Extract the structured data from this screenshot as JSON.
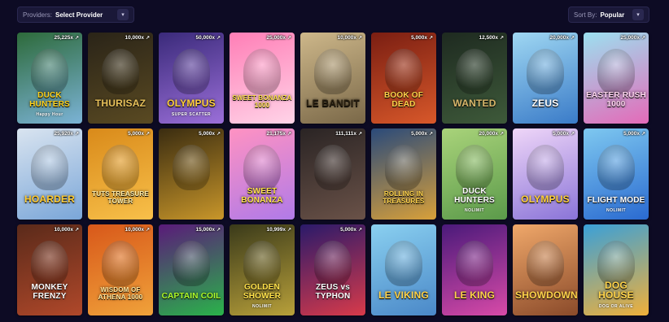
{
  "filters": {
    "providers_label": "Providers:",
    "providers_value": "Select Provider",
    "sort_label": "Sort By:",
    "sort_value": "Popular"
  },
  "games": [
    {
      "title": "DUCK HUNTERS",
      "subtitle": "Happy Hour",
      "multiplier": "25,225x",
      "bg": [
        "#2d6a3a",
        "#7bb3d6"
      ],
      "color": "#ffd21c"
    },
    {
      "title": "THURISAZ",
      "subtitle": "",
      "multiplier": "10,000x",
      "bg": [
        "#2a2418",
        "#5a4a22"
      ],
      "color": "#e8c15a"
    },
    {
      "title": "OLYMPUS",
      "subtitle": "SUPER SCATTER",
      "multiplier": "50,000x",
      "bg": [
        "#3a2a7a",
        "#9b6fd9"
      ],
      "color": "#ffcf3a"
    },
    {
      "title": "SWEET BONANZA 1000",
      "subtitle": "",
      "multiplier": "25,000x",
      "bg": [
        "#ff7eb6",
        "#ffd4e8"
      ],
      "color": "#ffe14a"
    },
    {
      "title": "LE BANDIT",
      "subtitle": "",
      "multiplier": "10,000x",
      "bg": [
        "#cdb78a",
        "#7a6848"
      ],
      "color": "#2a2010"
    },
    {
      "title": "BOOK OF DEAD",
      "subtitle": "",
      "multiplier": "5,000x",
      "bg": [
        "#7a1e12",
        "#d8582a"
      ],
      "color": "#ffd34a"
    },
    {
      "title": "WANTED",
      "subtitle": "",
      "multiplier": "12,500x",
      "bg": [
        "#1e2a20",
        "#3e5a3a"
      ],
      "color": "#d8b66a"
    },
    {
      "title": "ZEUS",
      "subtitle": "",
      "multiplier": "20,000x",
      "bg": [
        "#9fd7f2",
        "#3a7bc8"
      ],
      "color": "#ffffff"
    },
    {
      "title": "EASTER RUSH 1000",
      "subtitle": "",
      "multiplier": "25,000x",
      "bg": [
        "#9ce0f0",
        "#e46ab8"
      ],
      "color": "#ffd6f0"
    },
    {
      "title": "HOARDER",
      "subtitle": "",
      "multiplier": "25,920x",
      "bg": [
        "#d9e4f0",
        "#7aa6d8"
      ],
      "color": "#ffcc33"
    },
    {
      "title": "TUTS TREASURE TOWER",
      "subtitle": "",
      "multiplier": "5,000x",
      "bg": [
        "#d98a1a",
        "#f8c04a"
      ],
      "color": "#fff0b0"
    },
    {
      "title": "",
      "subtitle": "",
      "multiplier": "5,000x",
      "bg": [
        "#3a2c10",
        "#c8962a"
      ],
      "color": "#ffd34a"
    },
    {
      "title": "SWEET BONANZA",
      "subtitle": "",
      "multiplier": "21,175x",
      "bg": [
        "#ff92c2",
        "#b07ae8"
      ],
      "color": "#ffe14a"
    },
    {
      "title": "",
      "subtitle": "",
      "multiplier": "111,111x",
      "bg": [
        "#2a2424",
        "#6a5248"
      ],
      "color": "#e8c79a"
    },
    {
      "title": "ROLLING IN TREASURES",
      "subtitle": "",
      "multiplier": "5,000x",
      "bg": [
        "#2a4a7a",
        "#d8a03a"
      ],
      "color": "#ffd34a"
    },
    {
      "title": "DUCK HUNTERS",
      "subtitle": "NOLIMIT",
      "multiplier": "20,000x",
      "bg": [
        "#a9d37a",
        "#5b9a4a"
      ],
      "color": "#ffffff"
    },
    {
      "title": "OLYMPUS",
      "subtitle": "",
      "multiplier": "5,000x",
      "bg": [
        "#efd6f8",
        "#8a74d8"
      ],
      "color": "#ffcf3a"
    },
    {
      "title": "FLIGHT MODE",
      "subtitle": "NOLIMIT",
      "multiplier": "5,000x",
      "bg": [
        "#7ec8f0",
        "#2a6ad0"
      ],
      "color": "#ffffff"
    },
    {
      "title": "MONKEY FRENZY",
      "subtitle": "",
      "multiplier": "10,000x",
      "bg": [
        "#5a2a1a",
        "#b0482a"
      ],
      "color": "#ffffff"
    },
    {
      "title": "WISDOM OF ATHENA 1000",
      "subtitle": "",
      "multiplier": "10,000x",
      "bg": [
        "#d8581a",
        "#f0a23a"
      ],
      "color": "#ffe8a0"
    },
    {
      "title": "CAPTAIN COIL",
      "subtitle": "",
      "multiplier": "15,000x",
      "bg": [
        "#5a1a7a",
        "#2ab34a"
      ],
      "color": "#b0ff2a"
    },
    {
      "title": "GOLDEN SHOWER",
      "subtitle": "NOLIMIT",
      "multiplier": "10,999x",
      "bg": [
        "#3a3a1a",
        "#b8a03a"
      ],
      "color": "#ffe14a"
    },
    {
      "title": "ZEUS vs TYPHON",
      "subtitle": "",
      "multiplier": "5,000x",
      "bg": [
        "#2a1a6a",
        "#d83a4a"
      ],
      "color": "#ffffff"
    },
    {
      "title": "LE VIKING",
      "subtitle": "",
      "multiplier": "",
      "bg": [
        "#8ad0f0",
        "#4a88c8"
      ],
      "color": "#ffd34a"
    },
    {
      "title": "LE KING",
      "subtitle": "",
      "multiplier": "",
      "bg": [
        "#4a1a7a",
        "#d84aa8"
      ],
      "color": "#ffd34a"
    },
    {
      "title": "SHOWDOWN",
      "subtitle": "",
      "multiplier": "",
      "bg": [
        "#f0a86a",
        "#8a4a2a"
      ],
      "color": "#ffd34a"
    },
    {
      "title": "DOG HOUSE",
      "subtitle": "DOG OR ALIVE",
      "multiplier": "",
      "bg": [
        "#3aa0d8",
        "#f0b03a"
      ],
      "color": "#ffd34a"
    }
  ]
}
